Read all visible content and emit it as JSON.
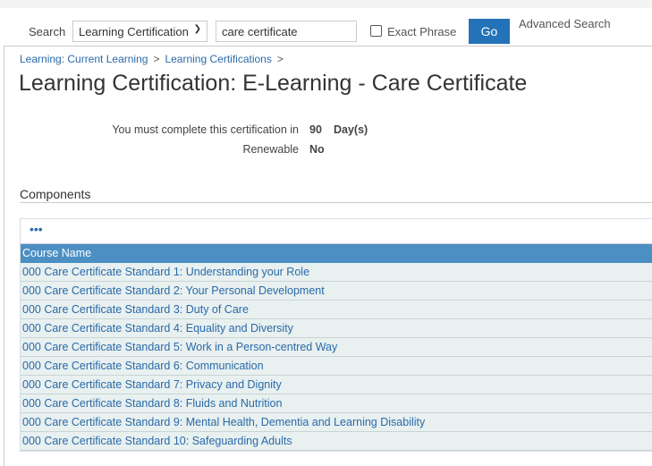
{
  "search": {
    "label": "Search",
    "scope": "Learning Certification",
    "query": "care certificate",
    "exact_phrase_label": "Exact Phrase",
    "exact_phrase_checked": false,
    "go_label": "Go",
    "advanced_label": "Advanced Search"
  },
  "breadcrumb": [
    {
      "label": "Learning: Current Learning"
    },
    {
      "label": "Learning Certifications"
    }
  ],
  "breadcrumb_sep": ">",
  "page_title": "Learning Certification: E-Learning - Care Certificate",
  "info": {
    "complete_label": "You must complete this certification in",
    "complete_value": "90",
    "complete_unit": "Day(s)",
    "renewable_label": "Renewable",
    "renewable_value": "No"
  },
  "components": {
    "heading": "Components",
    "toolbar_more": "•••",
    "column_header": "Course Name",
    "rows": [
      "000 Care Certificate Standard 1: Understanding your Role",
      "000 Care Certificate Standard 2: Your Personal Development",
      "000 Care Certificate Standard 3: Duty of Care",
      "000 Care Certificate Standard 4: Equality and Diversity",
      "000 Care Certificate Standard 5: Work in a Person-centred Way",
      "000 Care Certificate Standard 6: Communication",
      "000 Care Certificate Standard 7: Privacy and Dignity",
      "000 Care Certificate Standard 8: Fluids and Nutrition",
      "000 Care Certificate Standard 9: Mental Health, Dementia and Learning Disability",
      "000 Care Certificate Standard 10: Safeguarding Adults"
    ]
  }
}
